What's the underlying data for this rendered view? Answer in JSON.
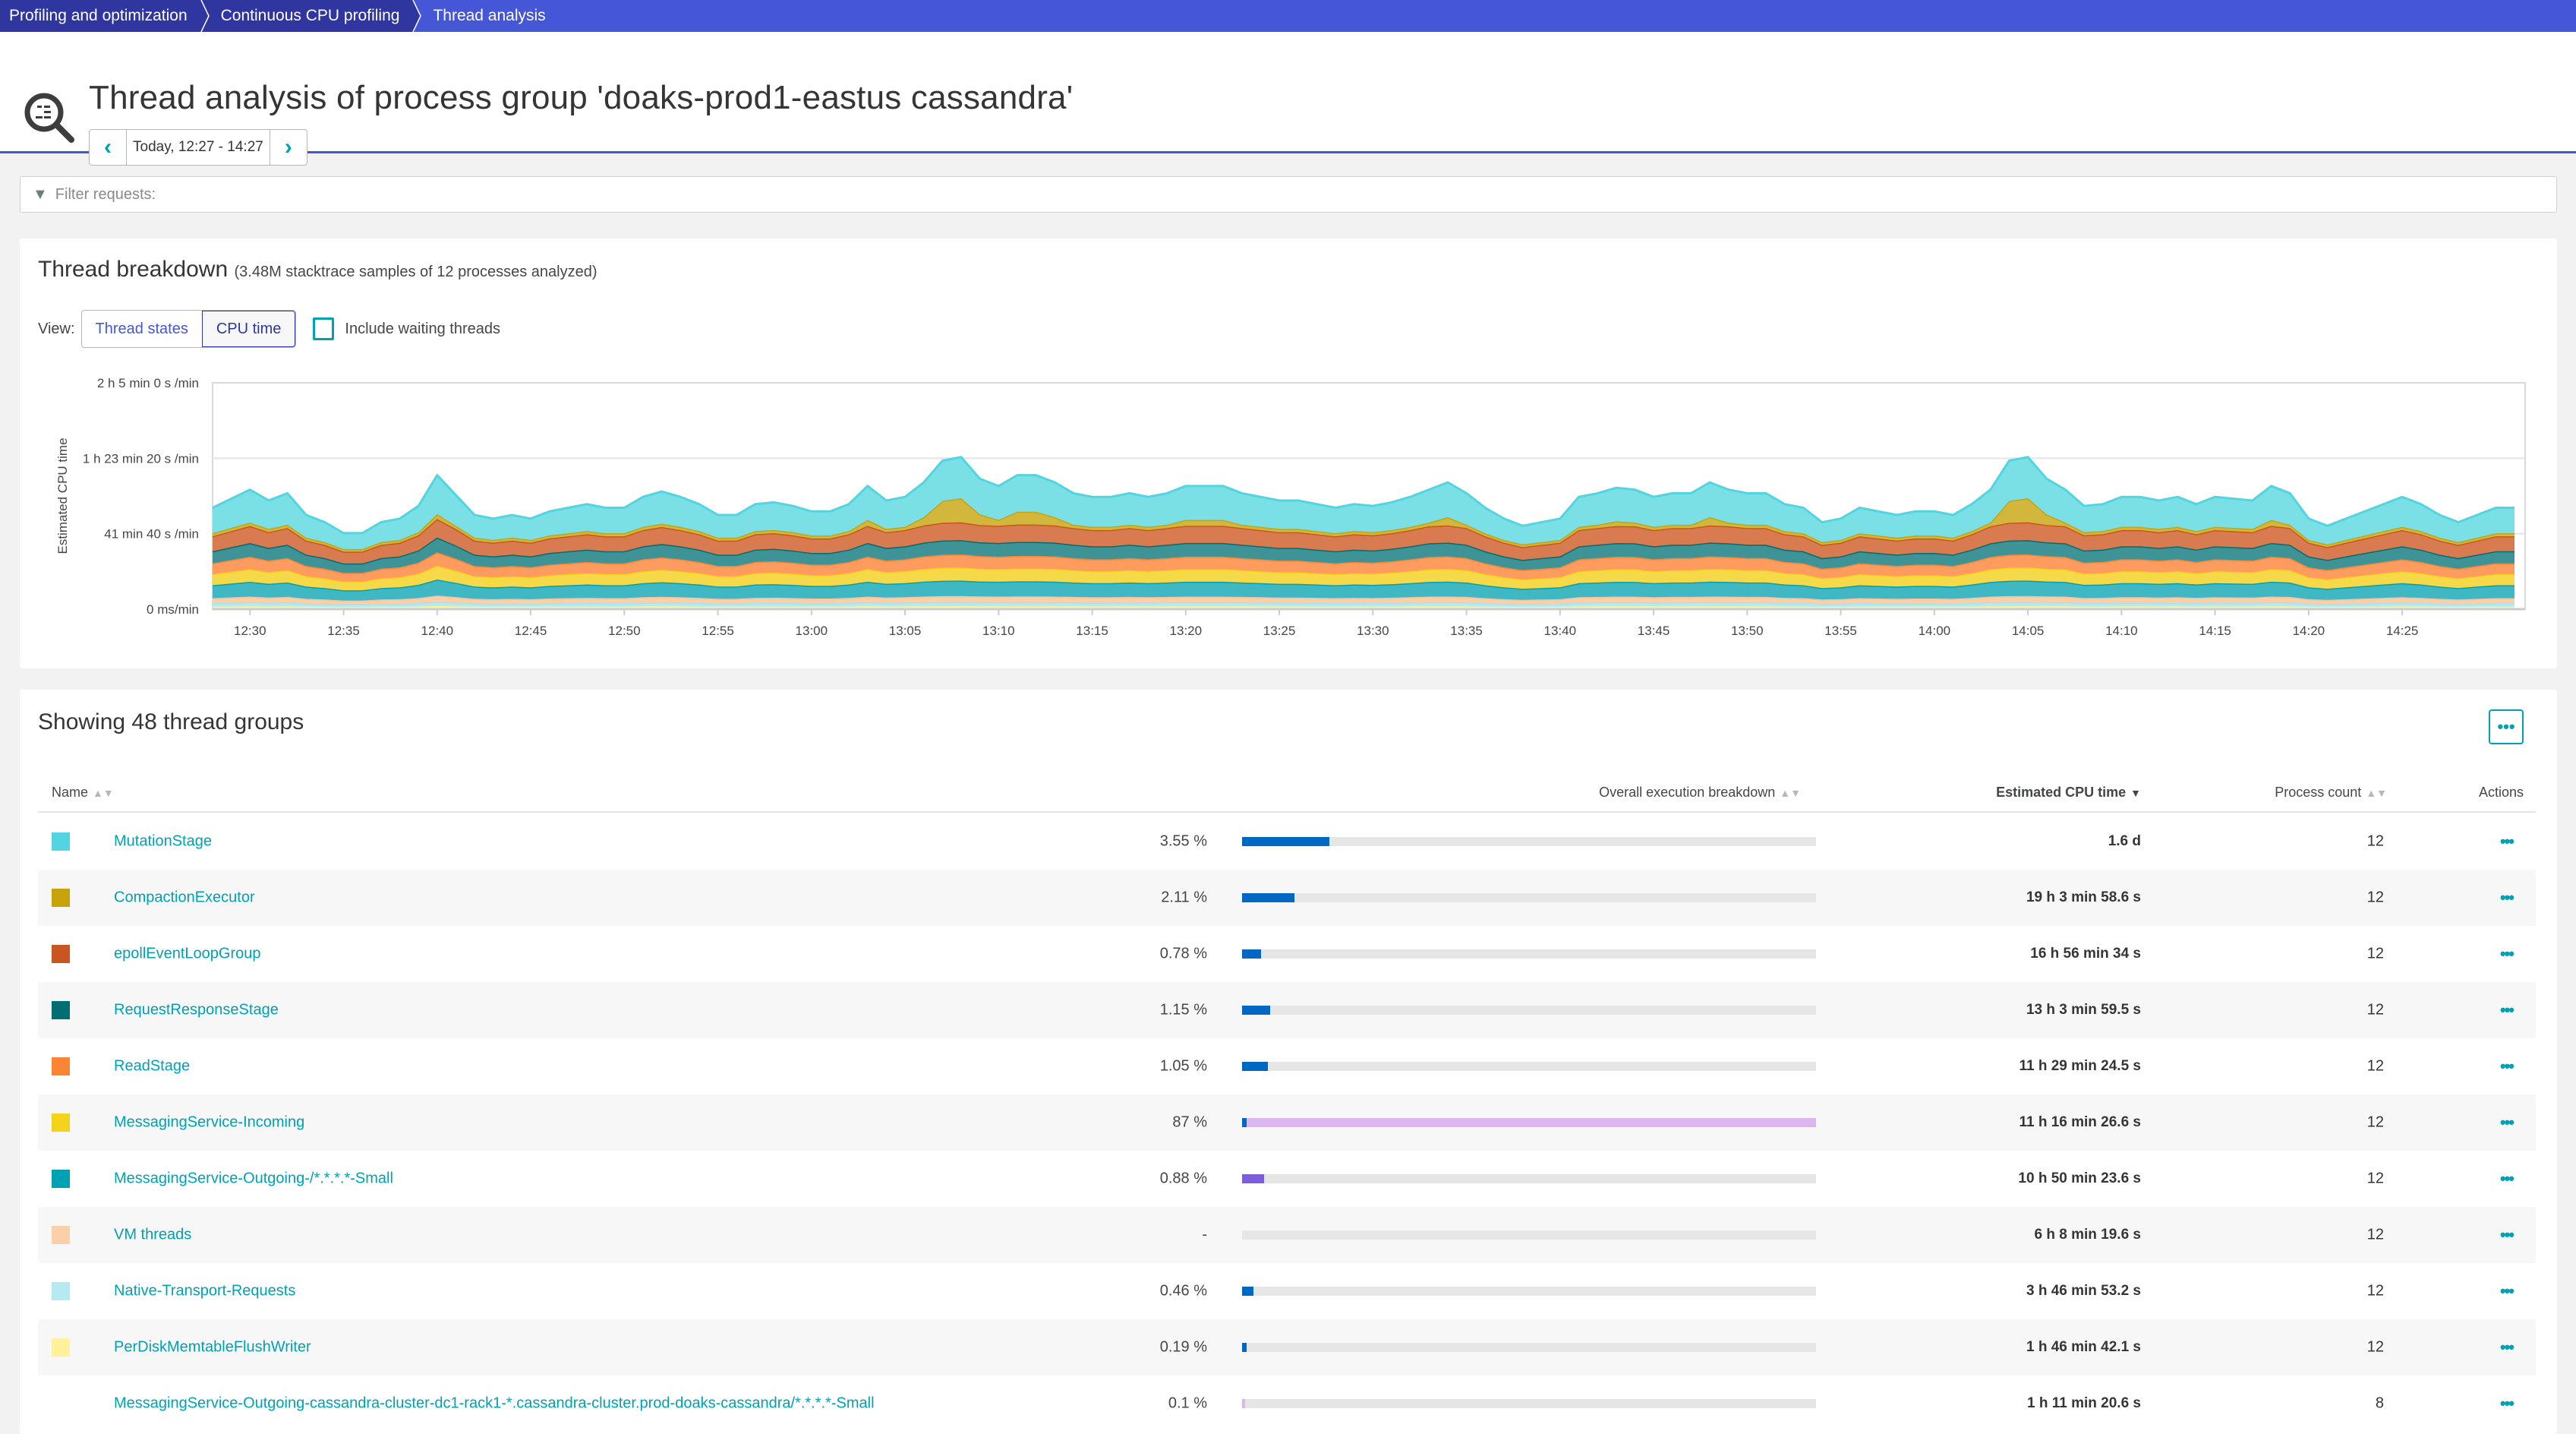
{
  "breadcrumbs": [
    "Profiling and optimization",
    "Continuous CPU profiling",
    "Thread analysis"
  ],
  "header": {
    "title": "Thread analysis of process group 'doaks-prod1-eastus cassandra'",
    "timeframe": "Today, 12:27 - 14:27",
    "prev_icon": "chevron-left-icon",
    "next_icon": "chevron-right-icon"
  },
  "filter": {
    "placeholder": "Filter requests:",
    "icon": "filter-icon"
  },
  "thread_breakdown": {
    "title": "Thread breakdown",
    "subtitle": "(3.48M stacktrace samples of 12 processes analyzed)",
    "view_label": "View:",
    "view_options": [
      "Thread states",
      "CPU time"
    ],
    "view_selected": "CPU time",
    "include_waiting_label": "Include waiting threads",
    "include_waiting_checked": false
  },
  "chart_data": {
    "type": "area",
    "stacked": true,
    "title": "",
    "xlabel": "",
    "ylabel": "Estimated CPU time",
    "y_unit": "min/min",
    "ylim": [
      0,
      125
    ],
    "y_ticks": [
      {
        "value": 0,
        "label": "0 ms/min"
      },
      {
        "value": 41.667,
        "label": "41 min 40 s /min"
      },
      {
        "value": 83.333,
        "label": "1 h 23 min 20 s /min"
      },
      {
        "value": 125,
        "label": "2 h 5 min 0 s /min"
      }
    ],
    "x_start": "12:28",
    "x_step_minutes": 1,
    "x_ticks": [
      "12:30",
      "12:35",
      "12:40",
      "12:45",
      "12:50",
      "12:55",
      "13:00",
      "13:05",
      "13:10",
      "13:15",
      "13:20",
      "13:25",
      "13:30",
      "13:35",
      "13:40",
      "13:45",
      "13:50",
      "13:55",
      "14:00",
      "14:05",
      "14:10",
      "14:15",
      "14:20",
      "14:25"
    ],
    "grid": true,
    "legend": "none",
    "totals": [
      56,
      61,
      66,
      60,
      64,
      52,
      48,
      42,
      42,
      48,
      50,
      57,
      74,
      63,
      52,
      50,
      52,
      50,
      54,
      56,
      58,
      56,
      56,
      62,
      65,
      62,
      58,
      52,
      52,
      58,
      59,
      57,
      54,
      54,
      58,
      68,
      60,
      62,
      70,
      82,
      84,
      72,
      68,
      74,
      74,
      70,
      64,
      62,
      62,
      64,
      62,
      64,
      68,
      68,
      68,
      64,
      62,
      60,
      60,
      58,
      56,
      58,
      57,
      59,
      62,
      66,
      70,
      64,
      56,
      50,
      46,
      48,
      50,
      62,
      64,
      67,
      66,
      62,
      64,
      64,
      70,
      66,
      64,
      64,
      58,
      56,
      48,
      50,
      56,
      54,
      52,
      54,
      54,
      52,
      58,
      66,
      82,
      84,
      72,
      66,
      57,
      58,
      62,
      62,
      60,
      62,
      58,
      62,
      61,
      60,
      68,
      64,
      50,
      46,
      50,
      54,
      58,
      62,
      58,
      52,
      48,
      52,
      56,
      56
    ],
    "series": [
      {
        "name": "PerDiskMemtableFlushWriter",
        "color": "#fff29a",
        "share": 0.025
      },
      {
        "name": "Native-Transport-Requests",
        "color": "#b4eaf0",
        "share": 0.035
      },
      {
        "name": "VM threads",
        "color": "#fccfa9",
        "share": 0.05
      },
      {
        "name": "MessagingService-Outgoing-/*.*.*.*-Small",
        "color": "#3fb8c4",
        "share": 0.13
      },
      {
        "name": "MessagingService-Incoming",
        "color": "#f6d949",
        "share": 0.11
      },
      {
        "name": "ReadStage",
        "color": "#fd9c5e",
        "share": 0.11
      },
      {
        "name": "RequestResponseStage",
        "color": "#3e9397",
        "share": 0.12
      },
      {
        "name": "epollEventLoopGroup",
        "color": "#d87b51",
        "share": 0.15
      },
      {
        "name": "CompactionExecutor",
        "color": "#d3b63c",
        "share": 0.1
      },
      {
        "name": "MutationStage",
        "color": "#7ae0e6",
        "share": 0.17
      }
    ],
    "series_line_colors": [
      "#fff29a",
      "#a6e5ee",
      "#f9c39a",
      "#00a1b2",
      "#f4d31a",
      "#fd8432",
      "#006e72",
      "#c9561e",
      "#c9a30a",
      "#52d5e0"
    ]
  },
  "table": {
    "title": "Showing 48 thread groups",
    "more_label": "•••",
    "columns": {
      "name": "Name",
      "breakdown": "Overall execution breakdown",
      "cpu": "Estimated CPU time",
      "process_count": "Process count",
      "actions": "Actions"
    },
    "sorted_by": "Estimated CPU time",
    "rows": [
      {
        "name": "MutationStage",
        "color": "#52d5e0",
        "pct": "3.55 %",
        "fill": 0.0355,
        "fill_color": "#0068c2",
        "cpu": "1.6 d",
        "process_count": "12"
      },
      {
        "name": "CompactionExecutor",
        "color": "#c9a30a",
        "pct": "2.11 %",
        "fill": 0.0211,
        "fill_color": "#0068c2",
        "cpu": "19 h 3 min 58.6 s",
        "process_count": "12"
      },
      {
        "name": "epollEventLoopGroup",
        "color": "#c9561e",
        "pct": "0.78 %",
        "fill": 0.0078,
        "fill_color": "#0068c2",
        "cpu": "16 h 56 min 34 s",
        "process_count": "12"
      },
      {
        "name": "RequestResponseStage",
        "color": "#006e72",
        "pct": "1.15 %",
        "fill": 0.0115,
        "fill_color": "#0068c2",
        "cpu": "13 h 3 min 59.5 s",
        "process_count": "12"
      },
      {
        "name": "ReadStage",
        "color": "#fd8432",
        "pct": "1.05 %",
        "fill": 0.0105,
        "fill_color": "#0068c2",
        "cpu": "11 h 29 min 24.5 s",
        "process_count": "12"
      },
      {
        "name": "MessagingService-Incoming",
        "color": "#f4d31a",
        "pct": "87 %",
        "fill": 0.004,
        "fill_color": "#0068c2",
        "fill2": 0.87,
        "fill2_color": "#dcb7ef",
        "cpu": "11 h 16 min 26.6 s",
        "process_count": "12"
      },
      {
        "name": "MessagingService-Outgoing-/*.*.*.*-Small",
        "color": "#00a1b2",
        "pct": "0.88 %",
        "fill": 0.0088,
        "fill_color": "#7c5ddb",
        "cpu": "10 h 50 min 23.6 s",
        "process_count": "12"
      },
      {
        "name": "VM threads",
        "color": "#fccfa9",
        "pct": "-",
        "fill": 0,
        "fill_color": "#0068c2",
        "cpu": "6 h 8 min 19.6 s",
        "process_count": "12"
      },
      {
        "name": "Native-Transport-Requests",
        "color": "#b4eaf0",
        "pct": "0.46 %",
        "fill": 0.0046,
        "fill_color": "#0068c2",
        "cpu": "3 h 46 min 53.2 s",
        "process_count": "12"
      },
      {
        "name": "PerDiskMemtableFlushWriter",
        "color": "#fff29a",
        "pct": "0.19 %",
        "fill": 0.0019,
        "fill_color": "#0068c2",
        "cpu": "1 h 46 min 42.1 s",
        "process_count": "12"
      },
      {
        "name": "MessagingService-Outgoing-cassandra-cluster-dc1-rack1-*.cassandra-cluster.prod-doaks-cassandra/*.*.*.*-Small",
        "color": "",
        "pct": "0.1 %",
        "fill": 0.001,
        "fill_color": "#dcb7ef",
        "cpu": "1 h 11 min 20.6 s",
        "process_count": "8"
      }
    ]
  }
}
